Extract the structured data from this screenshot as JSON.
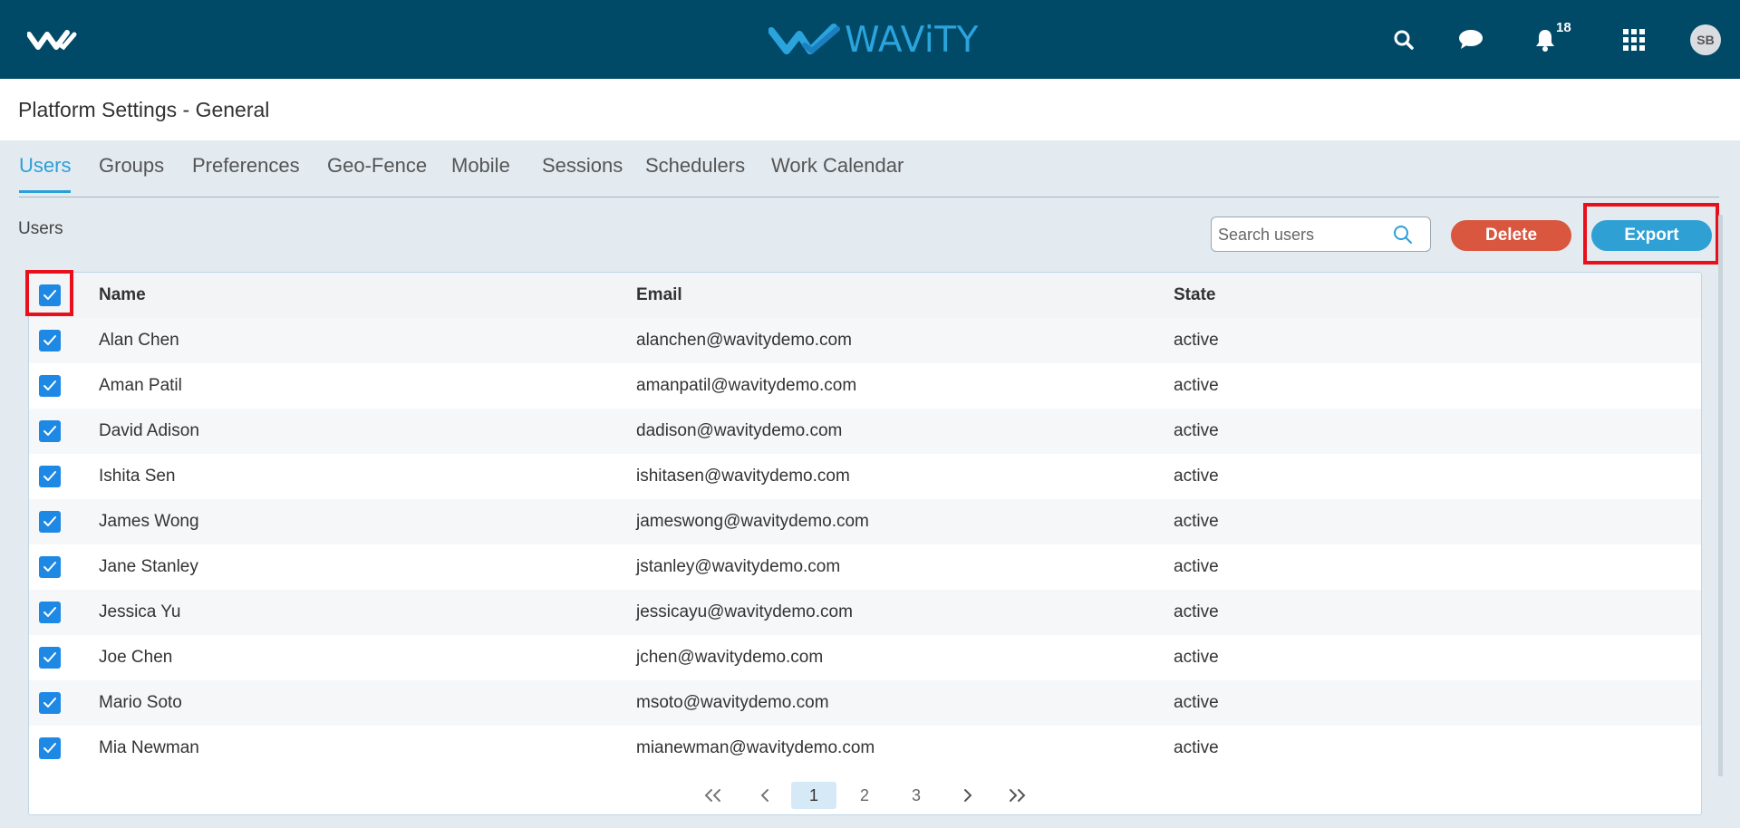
{
  "topbar": {
    "brand_text": "WAViTY",
    "notification_count": "18",
    "avatar_initials": "SB",
    "bar_color": "#004a68",
    "brand_color": "#2ba4dd"
  },
  "page": {
    "title": "Platform Settings - General"
  },
  "tabs": [
    {
      "label": "Users",
      "active": true
    },
    {
      "label": "Groups"
    },
    {
      "label": "Preferences"
    },
    {
      "label": "Geo-Fence"
    },
    {
      "label": "Mobile"
    },
    {
      "label": "Sessions"
    },
    {
      "label": "Schedulers"
    },
    {
      "label": "Work Calendar"
    }
  ],
  "toolbar": {
    "section_label": "Users",
    "search_placeholder": "Search users",
    "delete_label": "Delete",
    "export_label": "Export"
  },
  "table": {
    "columns": {
      "name": "Name",
      "email": "Email",
      "state": "State"
    },
    "select_all_checked": true,
    "rows": [
      {
        "name": "Alan Chen",
        "email": "alanchen@wavitydemo.com",
        "state": "active",
        "checked": true
      },
      {
        "name": "Aman Patil",
        "email": "amanpatil@wavitydemo.com",
        "state": "active",
        "checked": true
      },
      {
        "name": "David Adison",
        "email": "dadison@wavitydemo.com",
        "state": "active",
        "checked": true
      },
      {
        "name": "Ishita Sen",
        "email": "ishitasen@wavitydemo.com",
        "state": "active",
        "checked": true
      },
      {
        "name": "James Wong",
        "email": "jameswong@wavitydemo.com",
        "state": "active",
        "checked": true
      },
      {
        "name": "Jane Stanley",
        "email": "jstanley@wavitydemo.com",
        "state": "active",
        "checked": true
      },
      {
        "name": "Jessica Yu",
        "email": "jessicayu@wavitydemo.com",
        "state": "active",
        "checked": true
      },
      {
        "name": "Joe Chen",
        "email": "jchen@wavitydemo.com",
        "state": "active",
        "checked": true
      },
      {
        "name": "Mario Soto",
        "email": "msoto@wavitydemo.com",
        "state": "active",
        "checked": true
      },
      {
        "name": "Mia Newman",
        "email": "mianewman@wavitydemo.com",
        "state": "active",
        "checked": true
      }
    ]
  },
  "pagination": {
    "pages": [
      "1",
      "2",
      "3"
    ],
    "current": "1"
  }
}
